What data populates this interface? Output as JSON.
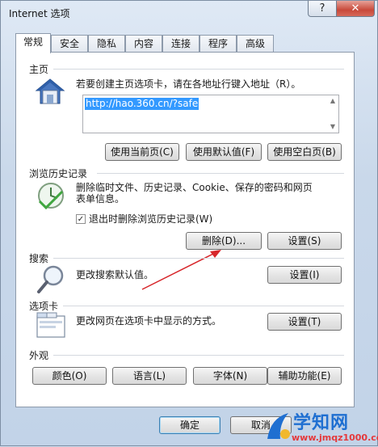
{
  "window": {
    "title": "Internet 选项",
    "help": "?",
    "close": "✕"
  },
  "tabs": [
    "常规",
    "安全",
    "隐私",
    "内容",
    "连接",
    "程序",
    "高级"
  ],
  "homepage": {
    "section": "主页",
    "instruction": "若要创建主页选项卡，请在各地址行键入地址（R）。",
    "url": "http://hao.360.cn/?safe",
    "buttons": [
      "使用当前页(C)",
      "使用默认值(F)",
      "使用空白页(B)"
    ]
  },
  "history": {
    "section": "浏览历史记录",
    "desc_line1": "删除临时文件、历史记录、Cookie、保存的密码和网页",
    "desc_line2": "表单信息。",
    "checkbox_label": "退出时删除浏览历史记录(W)",
    "checkbox_checked": true,
    "delete_button": "删除(D)...",
    "settings_button": "设置(S)"
  },
  "search": {
    "section": "搜索",
    "desc": "更改搜索默认值。",
    "settings_button": "设置(I)"
  },
  "tabbed": {
    "section": "选项卡",
    "desc": "更改网页在选项卡中显示的方式。",
    "settings_button": "设置(T)"
  },
  "appearance": {
    "section": "外观",
    "buttons": [
      "颜色(O)",
      "语言(L)",
      "字体(N)",
      "辅助功能(E)"
    ]
  },
  "footer": {
    "ok": "确定",
    "cancel": "取消"
  },
  "watermark": {
    "main": "学知网",
    "sub": "www.jmqz1000.com"
  }
}
